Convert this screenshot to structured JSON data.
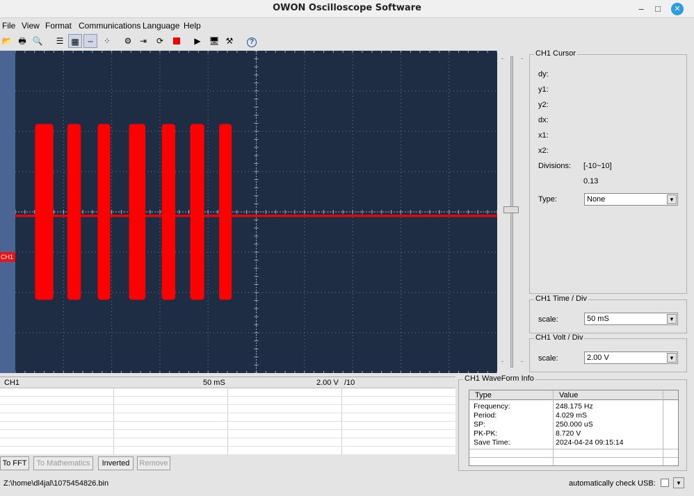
{
  "window": {
    "title": "OWON Oscilloscope Software"
  },
  "menu": [
    "File",
    "View",
    "Format",
    "Communications",
    "Language",
    "Help"
  ],
  "channel_marker": "CH1",
  "cursor": {
    "title": "CH1 Cursor",
    "dy": "dy:",
    "y1": "y1:",
    "y2": "y2:",
    "dx": "dx:",
    "x1": "x1:",
    "x2": "x2:",
    "divisions_label": "Divisions:",
    "divisions_range": "[-10~10]",
    "divisions_value": "0.13",
    "type_label": "Type:",
    "type_value": "None"
  },
  "time_div": {
    "title": "CH1 Time / Div",
    "scale_label": "scale:",
    "scale_value": "50 mS"
  },
  "volt_div": {
    "title": "CH1 Volt / Div",
    "scale_label": "scale:",
    "scale_value": "2.00 V"
  },
  "channel_table": {
    "ch": "CH1",
    "time": "50 mS",
    "volt": "2.00 V",
    "probe": "/10"
  },
  "buttons": {
    "fft": "To FFT",
    "math": "To Mathematics",
    "inverted": "Inverted",
    "remove": "Remove"
  },
  "waveform_info": {
    "title": "CH1 WaveForm Info",
    "header_type": "Type",
    "header_value": "Value",
    "rows": [
      {
        "type": "Frequency:",
        "value": "248.175 Hz"
      },
      {
        "type": "Period:",
        "value": "4.029 mS"
      },
      {
        "type": "SP:",
        "value": "250.000 uS"
      },
      {
        "type": "PK-PK:",
        "value": "8.720 V"
      },
      {
        "type": "Save Time:",
        "value": "2024-04-24 09:15:14"
      }
    ]
  },
  "status": {
    "path": "Z:\\home\\dl4jal\\1075454826.bin",
    "usb_label": "automatically check USB:"
  },
  "colors": {
    "trace": "#ff0000",
    "screen": "#1f2d44",
    "grid": "#6f7f98"
  },
  "chart_data": {
    "type": "line",
    "series": [
      {
        "values": [
          0.0,
          0.0,
          4.36,
          -4.36,
          0.0,
          4.36,
          -4.36,
          0.0,
          4.36,
          -4.36,
          0.0,
          4.36,
          -4.36,
          0.0,
          4.36,
          -4.36,
          0.0,
          4.36,
          -4.36,
          0.0,
          4.36,
          -4.36,
          0.0,
          0.0,
          0.0,
          0.0
        ]
      }
    ],
    "bursts": [
      {
        "start": 0.41,
        "end": 0.79
      },
      {
        "start": 1.08,
        "end": 1.36
      },
      {
        "start": 1.71,
        "end": 1.97
      },
      {
        "start": 2.36,
        "end": 2.7
      },
      {
        "start": 3.04,
        "end": 3.32
      },
      {
        "start": 3.63,
        "end": 3.92
      },
      {
        "start": 4.23,
        "end": 4.49
      }
    ],
    "x_divisions": 10,
    "y_divisions": 8,
    "ylim": [
      -8.0,
      8.0
    ],
    "baseline": -0.2,
    "amplitude": 4.36,
    "grid": true
  }
}
